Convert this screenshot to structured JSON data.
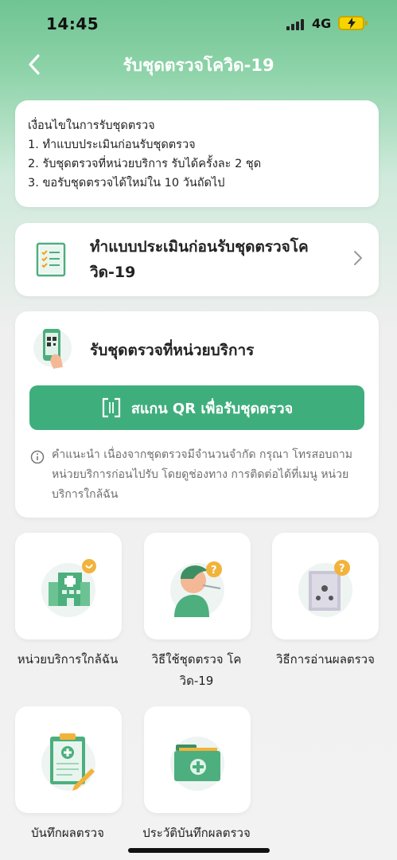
{
  "status": {
    "time": "14:45",
    "network": "4G"
  },
  "nav": {
    "title": "รับชุดตรวจโควิด-19"
  },
  "conditions": {
    "heading": "เงื่อนไขในการรับชุดตรวจ",
    "items": [
      "1. ทำแบบประเมินก่อนรับชุดตรวจ",
      "2. รับชุดตรวจที่หน่วยบริการ รับได้ครั้งละ 2 ชุด",
      "3. ขอรับชุดตรวจได้ใหม่ใน 10 วันถัดไป"
    ]
  },
  "assessment": {
    "title": "ทำแบบประเมินก่อนรับชุดตรวจโควิด-19"
  },
  "receive": {
    "title": "รับชุดตรวจที่หน่วยบริการ",
    "scan_label": "สแกน QR เพื่อรับชุดตรวจ",
    "hint": "คำแนะนำ เนื่องจากชุดตรวจมีจำนวนจำกัด กรุณา โทรสอบถามหน่วยบริการก่อนไปรับ โดยดูช่องทาง การติดต่อได้ที่เมนู หน่วยบริการใกล้ฉัน"
  },
  "menu": [
    {
      "label": "หน่วยบริการใกล้ฉัน",
      "icon": "hospital-icon"
    },
    {
      "label": "วิธีใช้ชุดตรวจ โควิด-19",
      "icon": "swab-test-icon"
    },
    {
      "label": "วิธีการอ่านผลตรวจ",
      "icon": "test-kit-icon"
    },
    {
      "label": "บันทึกผลตรวจ",
      "icon": "clipboard-record-icon"
    },
    {
      "label": "ประวัติบันทึกผลตรวจ",
      "icon": "history-folder-icon"
    }
  ],
  "colors": {
    "accent": "#3fae7d",
    "header_green": "#6fc493"
  }
}
